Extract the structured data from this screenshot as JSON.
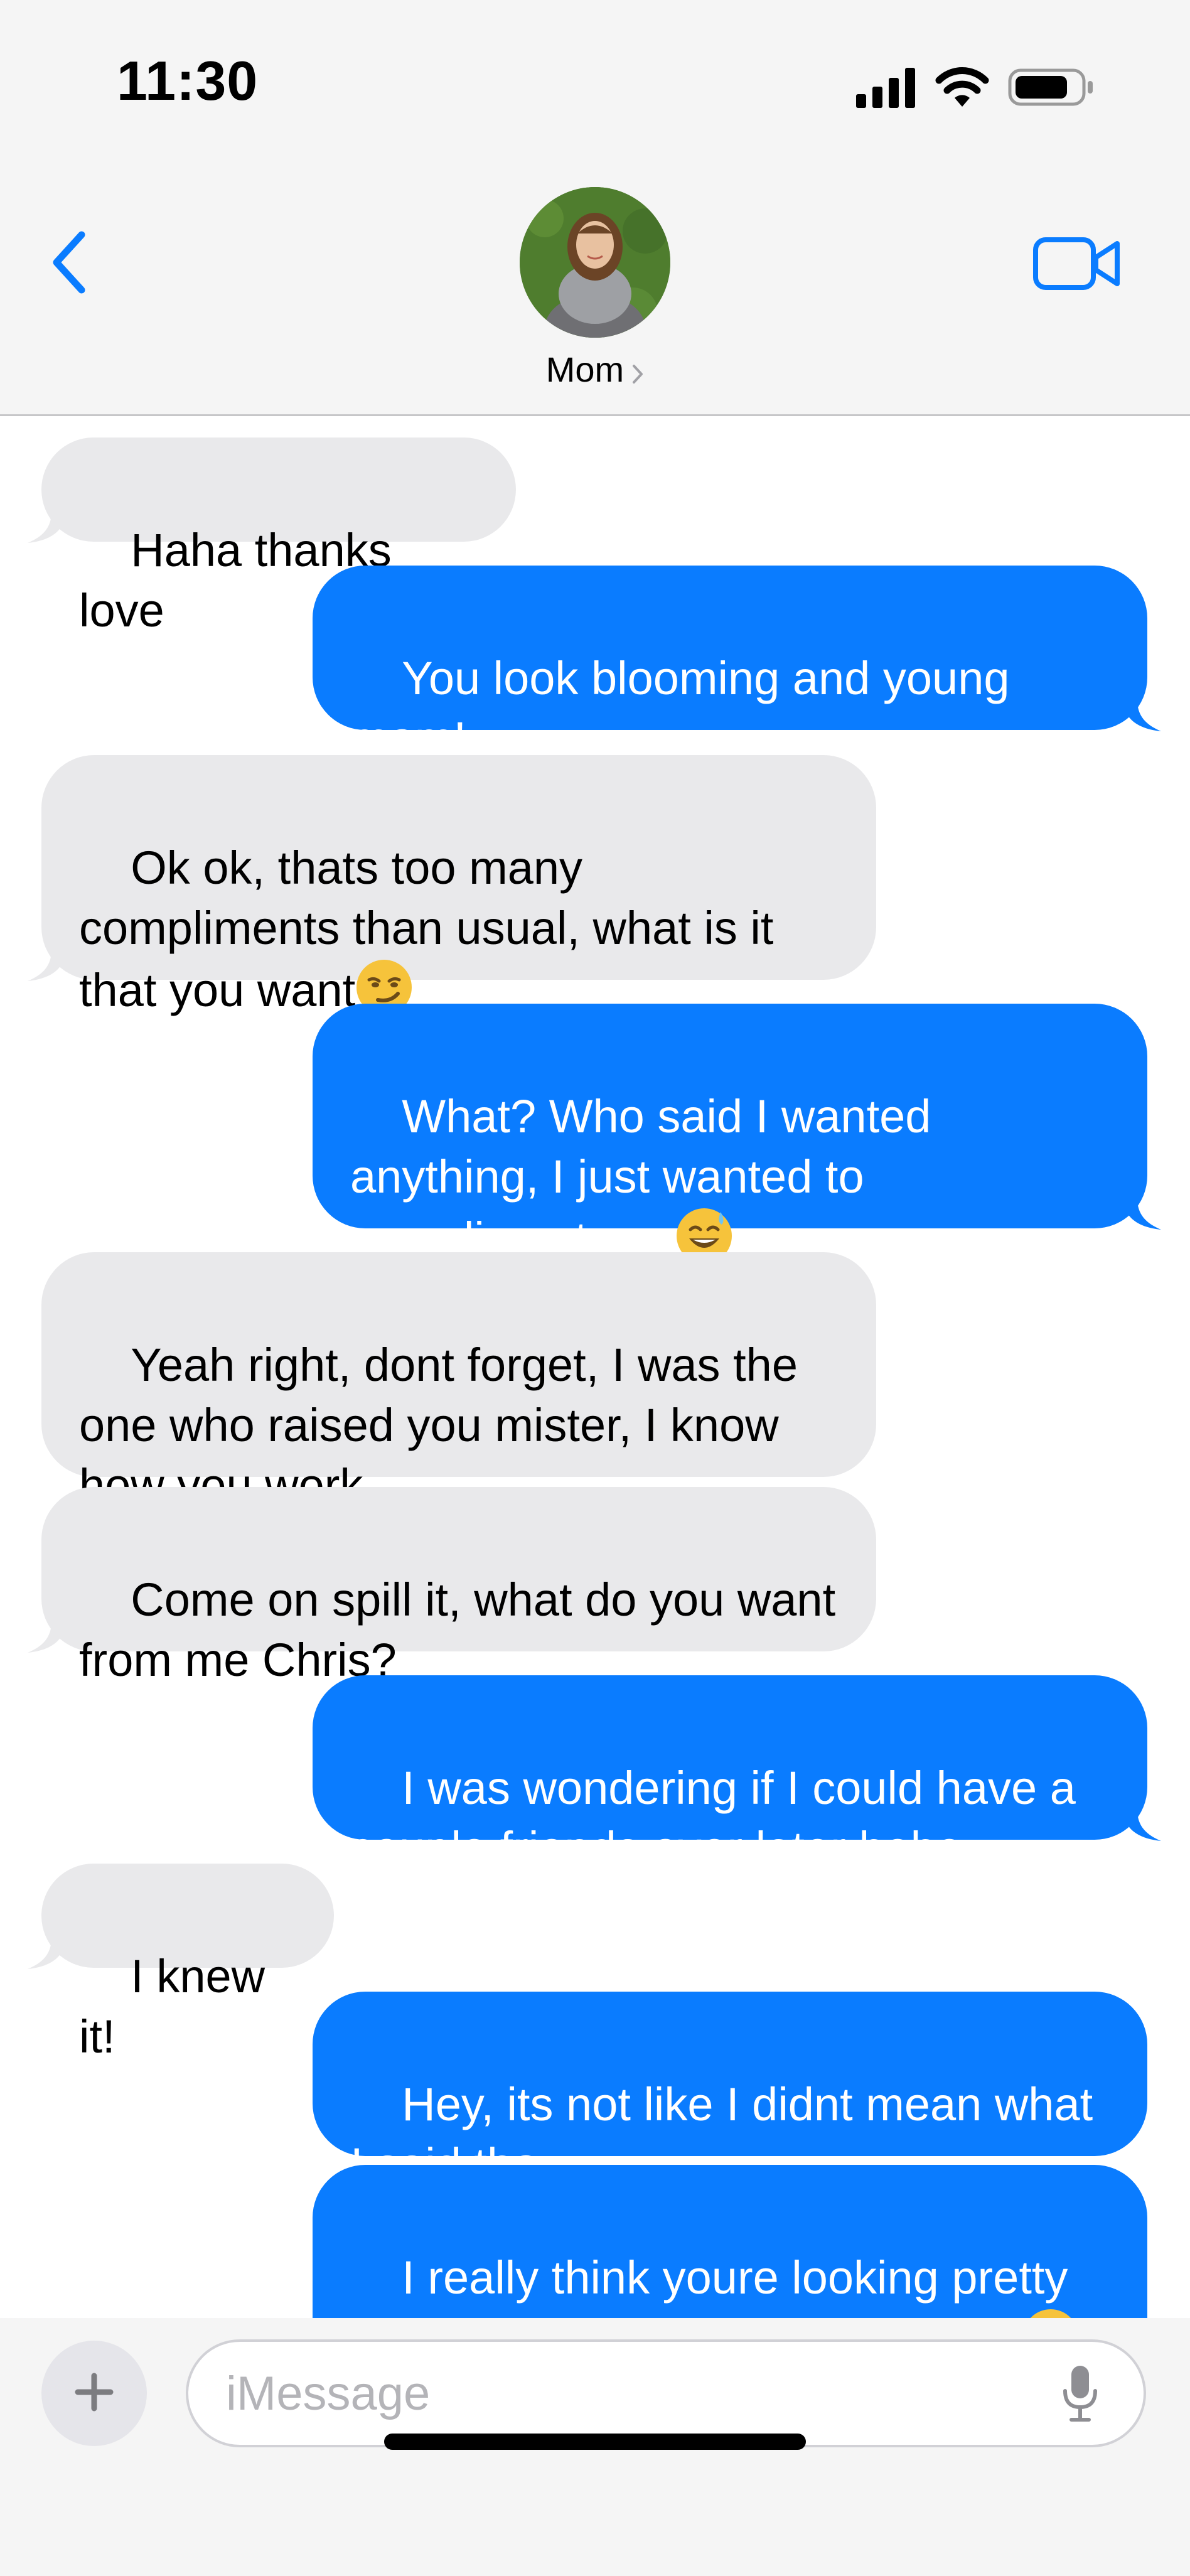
{
  "status_bar": {
    "time": "11:30",
    "icons": [
      "cellular-signal-icon",
      "wifi-icon",
      "battery-icon"
    ]
  },
  "header": {
    "contact_name": "Mom",
    "back_icon": "chevron-left-icon",
    "video_icon": "video-camera-icon",
    "accent_color": "#0a7cff"
  },
  "messages": [
    {
      "from": "them",
      "text": "Haha thanks love"
    },
    {
      "from": "me",
      "text": "You look blooming and young mom!"
    },
    {
      "from": "them",
      "text": "Ok ok, thats too many compliments than usual, what is it that you want",
      "emoji": "smirking-face"
    },
    {
      "from": "me",
      "text": "What? Who said I wanted anything, I just wanted to compliment you",
      "emoji": "grinning-face-with-sweat"
    },
    {
      "from": "them",
      "text": "Yeah right, dont forget, I was the one who raised you mister, I know how you work"
    },
    {
      "from": "them",
      "text": "Come on spill it, what do you want from me Chris?"
    },
    {
      "from": "me",
      "text": "I was wondering if I could have a couple friends over later hehe"
    },
    {
      "from": "them",
      "text": "I knew it!"
    },
    {
      "from": "me",
      "text": "Hey, its not like I didnt mean what I said tho"
    },
    {
      "from": "me",
      "text": "I really think youre looking pretty young and cute these days mom",
      "emoji": "smiling-face"
    }
  ],
  "colors": {
    "incoming_bubble": "#e9e9eb",
    "outgoing_bubble": "#0a7cff"
  },
  "composer": {
    "placeholder": "iMessage",
    "value": "",
    "plus_icon": "plus-icon",
    "mic_icon": "microphone-icon"
  }
}
